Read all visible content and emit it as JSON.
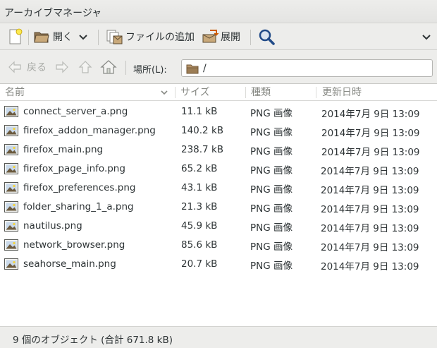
{
  "window": {
    "title": "アーカイブマネージャ"
  },
  "toolbar": {
    "new_icon": "new-archive-icon",
    "open_label": "開く",
    "add_files_label": "ファイルの追加",
    "extract_label": "展開",
    "search_icon": "search-icon",
    "menu_icon": "chevron-down-icon"
  },
  "location": {
    "back_label": "戻る",
    "location_label": "場所(L):",
    "path": "/"
  },
  "columns": {
    "name": "名前",
    "size": "サイズ",
    "type": "種類",
    "modified": "更新日時"
  },
  "files": [
    {
      "name": "connect_server_a.png",
      "size": "11.1 kB",
      "type": "PNG 画像",
      "modified": "2014年7月 9日 13:09"
    },
    {
      "name": "firefox_addon_manager.png",
      "size": "140.2 kB",
      "type": "PNG 画像",
      "modified": "2014年7月 9日 13:09"
    },
    {
      "name": "firefox_main.png",
      "size": "238.7 kB",
      "type": "PNG 画像",
      "modified": "2014年7月 9日 13:09"
    },
    {
      "name": "firefox_page_info.png",
      "size": "65.2 kB",
      "type": "PNG 画像",
      "modified": "2014年7月 9日 13:09"
    },
    {
      "name": "firefox_preferences.png",
      "size": "43.1 kB",
      "type": "PNG 画像",
      "modified": "2014年7月 9日 13:09"
    },
    {
      "name": "folder_sharing_1_a.png",
      "size": "21.3 kB",
      "type": "PNG 画像",
      "modified": "2014年7月 9日 13:09"
    },
    {
      "name": "nautilus.png",
      "size": "45.9 kB",
      "type": "PNG 画像",
      "modified": "2014年7月 9日 13:09"
    },
    {
      "name": "network_browser.png",
      "size": "85.6 kB",
      "type": "PNG 画像",
      "modified": "2014年7月 9日 13:09"
    },
    {
      "name": "seahorse_main.png",
      "size": "20.7 kB",
      "type": "PNG 画像",
      "modified": "2014年7月 9日 13:09"
    }
  ],
  "status": {
    "text": "9 個のオブジェクト (合計 671.8 kB)"
  }
}
